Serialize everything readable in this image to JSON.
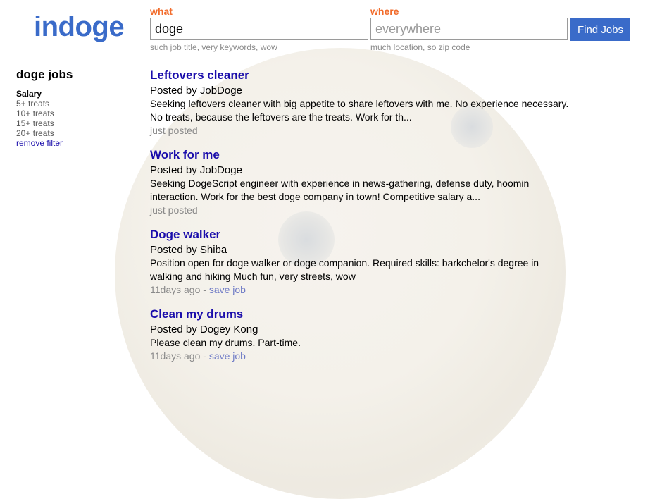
{
  "logo": "indoge",
  "search": {
    "what_label": "what",
    "what_value": "doge",
    "what_hint": "such job title, very keywords, wow",
    "where_label": "where",
    "where_placeholder": "everywhere",
    "where_hint": "much location, so zip code",
    "button_label": "Find Jobs"
  },
  "sidebar": {
    "title": "doge jobs",
    "filter_heading": "Salary",
    "items": [
      "5+ treats",
      "10+ treats",
      "15+ treats",
      "20+ treats"
    ],
    "remove_filter": "remove filter"
  },
  "jobs": [
    {
      "title": "Leftovers cleaner",
      "poster": "Posted by JobDoge",
      "description": "Seeking leftovers cleaner with big appetite to share leftovers with me. No experience necessary. No treats, because the leftovers are the treats. Work for th...",
      "posted": "just posted",
      "save": ""
    },
    {
      "title": "Work for me",
      "poster": "Posted by JobDoge",
      "description": "Seeking DogeScript engineer with experience in news-gathering, defense duty, hoomin interaction. Work for the best doge company in town! Competitive salary a...",
      "posted": "just posted",
      "save": ""
    },
    {
      "title": "Doge walker",
      "poster": "Posted by Shiba",
      "description": "Position open for doge walker or doge companion. Required skills: barkchelor's degree in walking and hiking Much fun, very streets, wow",
      "posted": "11days ago",
      "separator": " - ",
      "save": "save job"
    },
    {
      "title": "Clean my drums",
      "poster": "Posted by Dogey Kong",
      "description": "Please clean my drums. Part-time.",
      "posted": "11days ago",
      "separator": " - ",
      "save": "save job"
    }
  ]
}
